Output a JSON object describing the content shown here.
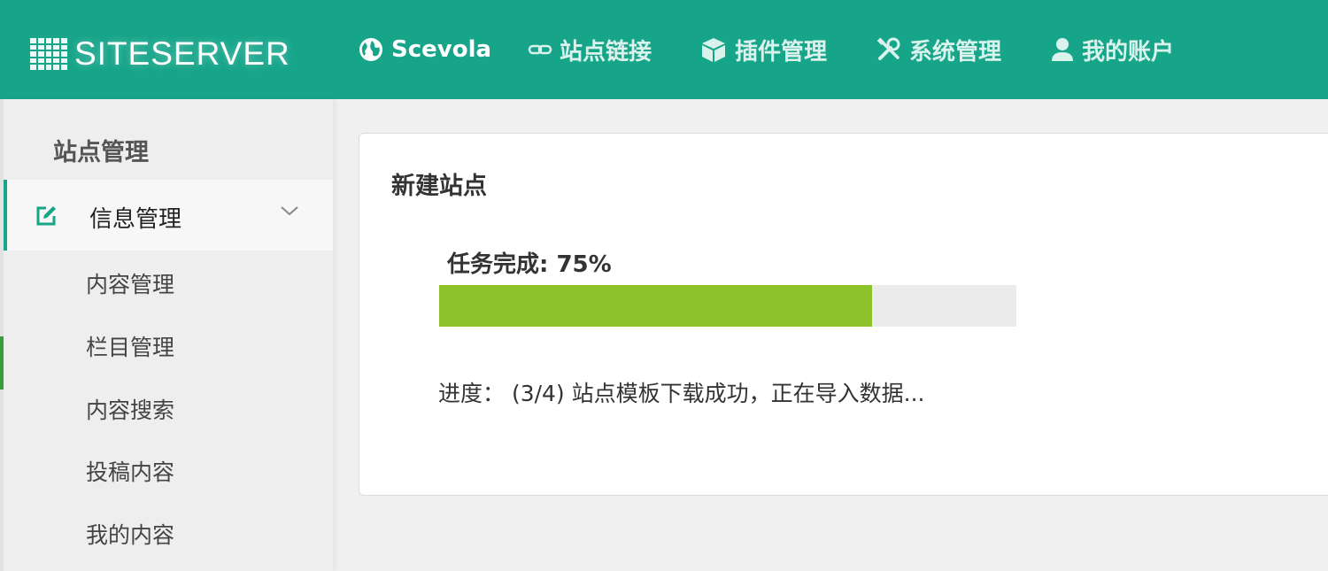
{
  "brand": {
    "name": "SITESERVER"
  },
  "nav": {
    "items": [
      {
        "label": "Scevola",
        "icon": "globe-icon",
        "active": true
      },
      {
        "label": "站点链接",
        "icon": "link-icon"
      },
      {
        "label": "插件管理",
        "icon": "cube-icon"
      },
      {
        "label": "系统管理",
        "icon": "tools-icon"
      },
      {
        "label": "我的账户",
        "icon": "user-icon"
      }
    ]
  },
  "sidebar": {
    "title": "站点管理",
    "group": {
      "label": "信息管理",
      "icon": "edit-icon",
      "expanded": true
    },
    "items": [
      {
        "label": "内容管理"
      },
      {
        "label": "栏目管理"
      },
      {
        "label": "内容搜索"
      },
      {
        "label": "投稿内容"
      },
      {
        "label": "我的内容"
      }
    ]
  },
  "main": {
    "title": "新建站点",
    "task_label": "任务完成: 75%",
    "progress_percent": 75,
    "status": "进度： (3/4) 站点模板下载成功，正在导入数据..."
  },
  "colors": {
    "brand": "#17a58a",
    "progress": "#8dc22b"
  }
}
